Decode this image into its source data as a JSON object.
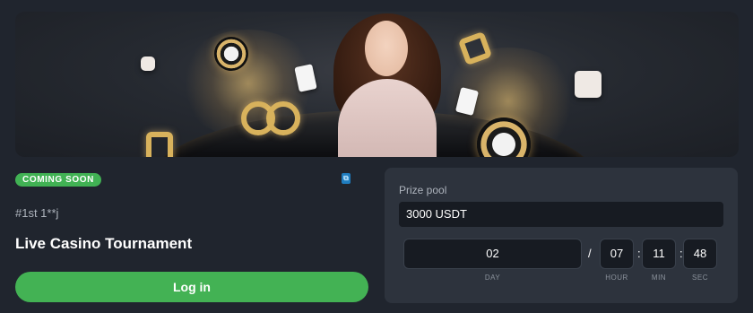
{
  "banner": {
    "alt": "Live casino promotional banner"
  },
  "status_badge": "COMING SOON",
  "tournament": {
    "id_label": "#1st 1**j",
    "title": "Live Casino Tournament",
    "login_label": "Log in"
  },
  "prize_pool": {
    "label": "Prize pool",
    "value": "3000 USDT"
  },
  "countdown": {
    "day": "02",
    "hour": "07",
    "min": "11",
    "sec": "48",
    "day_label": "DAY",
    "hour_label": "HOUR",
    "min_label": "MIN",
    "sec_label": "SEC",
    "slash": "/",
    "colon": ":"
  },
  "colors": {
    "accent_green": "#43b254",
    "panel_bg": "#2d333d",
    "field_bg": "#171b22"
  },
  "icons": {
    "info_icon": "small-blue-tag-icon"
  }
}
